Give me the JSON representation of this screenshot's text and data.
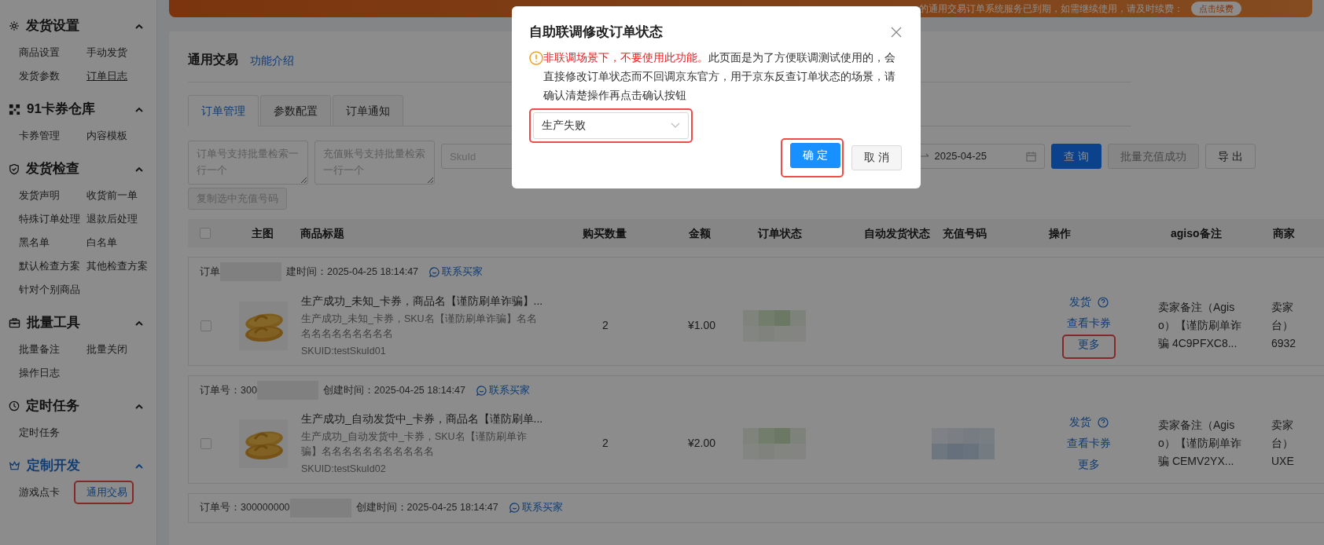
{
  "sidebar": {
    "groups": [
      {
        "title": "发货设置",
        "active": false,
        "expanded": true,
        "items": [
          {
            "label": "商品设置",
            "selected": false,
            "underlined": false,
            "annotated": false
          },
          {
            "label": "手动发货",
            "selected": false,
            "underlined": false,
            "annotated": false
          },
          {
            "label": "发货参数",
            "selected": false,
            "underlined": false,
            "annotated": false
          },
          {
            "label": "订单日志",
            "selected": false,
            "underlined": true,
            "annotated": false
          }
        ]
      },
      {
        "title": "91卡券仓库",
        "active": false,
        "expanded": true,
        "items": [
          {
            "label": "卡券管理",
            "selected": false,
            "underlined": false,
            "annotated": false
          },
          {
            "label": "内容模板",
            "selected": false,
            "underlined": false,
            "annotated": false
          }
        ]
      },
      {
        "title": "发货检查",
        "active": false,
        "expanded": true,
        "items": [
          {
            "label": "发货声明",
            "selected": false,
            "underlined": false,
            "annotated": false
          },
          {
            "label": "收货前一单",
            "selected": false,
            "underlined": false,
            "annotated": false
          },
          {
            "label": "特殊订单处理",
            "selected": false,
            "underlined": false,
            "annotated": false
          },
          {
            "label": "退款后处理",
            "selected": false,
            "underlined": false,
            "annotated": false
          },
          {
            "label": "黑名单",
            "selected": false,
            "underlined": false,
            "annotated": false
          },
          {
            "label": "白名单",
            "selected": false,
            "underlined": false,
            "annotated": false
          },
          {
            "label": "默认检查方案",
            "selected": false,
            "underlined": false,
            "annotated": false
          },
          {
            "label": "其他检查方案",
            "selected": false,
            "underlined": false,
            "annotated": false
          },
          {
            "label": "针对个别商品",
            "selected": false,
            "underlined": false,
            "annotated": false
          }
        ]
      },
      {
        "title": "批量工具",
        "active": false,
        "expanded": true,
        "items": [
          {
            "label": "批量备注",
            "selected": false,
            "underlined": false,
            "annotated": false
          },
          {
            "label": "批量关闭",
            "selected": false,
            "underlined": false,
            "annotated": false
          },
          {
            "label": "操作日志",
            "selected": false,
            "underlined": false,
            "annotated": false
          }
        ]
      },
      {
        "title": "定时任务",
        "active": false,
        "expanded": true,
        "items": [
          {
            "label": "定时任务",
            "selected": false,
            "underlined": false,
            "annotated": false
          }
        ]
      },
      {
        "title": "定制开发",
        "active": true,
        "expanded": true,
        "items": [
          {
            "label": "游戏点卡",
            "selected": false,
            "underlined": false,
            "annotated": false
          },
          {
            "label": "通用交易",
            "selected": true,
            "underlined": false,
            "annotated": true
          }
        ]
      }
    ]
  },
  "banner": {
    "text": "的通用交易订单系统服务已到期，如需继续使用，请及时续费：",
    "button": "点击续费"
  },
  "page": {
    "title": "通用交易",
    "intro_link": "功能介绍",
    "tabs": [
      {
        "label": "订单管理",
        "selected": true
      },
      {
        "label": "参数配置",
        "selected": false
      },
      {
        "label": "订单通知",
        "selected": false
      }
    ],
    "filters": {
      "fields": [
        {
          "kind": "textarea",
          "placeholder": "订单号支持批量检索一行一个"
        },
        {
          "kind": "textarea",
          "placeholder": "充值账号支持批量检索一行一个"
        },
        {
          "kind": "input",
          "placeholder": "SkuId"
        },
        {
          "kind": "date_range",
          "end": "2025-04-25"
        }
      ],
      "buttons": [
        {
          "label": "查 询",
          "kind": "primary",
          "disabled": false
        },
        {
          "label": "批量充值成功",
          "kind": "default",
          "disabled": true
        },
        {
          "label": "导 出",
          "kind": "default",
          "disabled": false
        }
      ],
      "copy_button": {
        "label": "复制选中充值号码",
        "disabled": true
      }
    },
    "table": {
      "select_all_checked": false,
      "columns": [
        "主图",
        "商品标题",
        "购买数量",
        "金额",
        "订单状态",
        "自动发货状态",
        "充值号码",
        "操作",
        "agiso备注",
        "商家"
      ],
      "orders": [
        {
          "order_no": "订单",
          "created": "建时间：2025-04-25 18:14:47",
          "contact": "联系买家",
          "checked": false,
          "title": "生产成功_未知_卡券，商品名【谨防刷单诈骗】...",
          "sku": "生产成功_未知_卡券，SKU名【谨防刷单诈骗】名名名名名名名名名名名",
          "skuid": "SKUID:testSkuId01",
          "qty": "2",
          "amount": "¥1.00",
          "actions": [
            {
              "label": "发货",
              "help": true,
              "annotated": false
            },
            {
              "label": "查看卡券",
              "help": false,
              "annotated": false
            },
            {
              "label": "更多",
              "help": false,
              "annotated": true
            }
          ],
          "agiso_note": "卖家备注（Agiso）【谨防刷单诈骗 4C9PFXC8...",
          "merchant_note": [
            "卖家",
            "台）",
            "6932"
          ]
        },
        {
          "order_no": "订单号：300",
          "created": "创建时间：2025-04-25 18:14:47",
          "contact": "联系买家",
          "checked": false,
          "title": "生产成功_自动发货中_卡券，商品名【谨防刷单...",
          "sku": "生产成功_自动发货中_卡券，SKU名【谨防刷单诈骗】名名名名名名名名名名名",
          "skuid": "SKUID:testSkuId02",
          "qty": "2",
          "amount": "¥2.00",
          "actions": [
            {
              "label": "发货",
              "help": true,
              "annotated": false
            },
            {
              "label": "查看卡券",
              "help": false,
              "annotated": false
            },
            {
              "label": "更多",
              "help": false,
              "annotated": false
            }
          ],
          "agiso_note": "卖家备注（Agiso）【谨防刷单诈骗 CEMV2YX...",
          "merchant_note": [
            "卖家",
            "台）",
            "UXE"
          ]
        },
        {
          "order_no": "订单号：300000000",
          "created": "创建时间：2025-04-25 18:14:47",
          "contact": "联系买家"
        }
      ]
    }
  },
  "modal": {
    "title": "自助联调修改订单状态",
    "warning": "非联调场景下，不要使用此功能。",
    "text": "此页面是为了方便联调测试使用的，会直接修改订单状态而不回调京东官方，用于京东反查订单状态的场景，请确认清楚操作再点击确认按钮",
    "select": {
      "value": "生产失败",
      "annotated": true
    },
    "buttons": [
      {
        "label": "确 定",
        "kind": "primary",
        "annotated": true
      },
      {
        "label": "取 消",
        "kind": "default",
        "annotated": false
      }
    ]
  }
}
